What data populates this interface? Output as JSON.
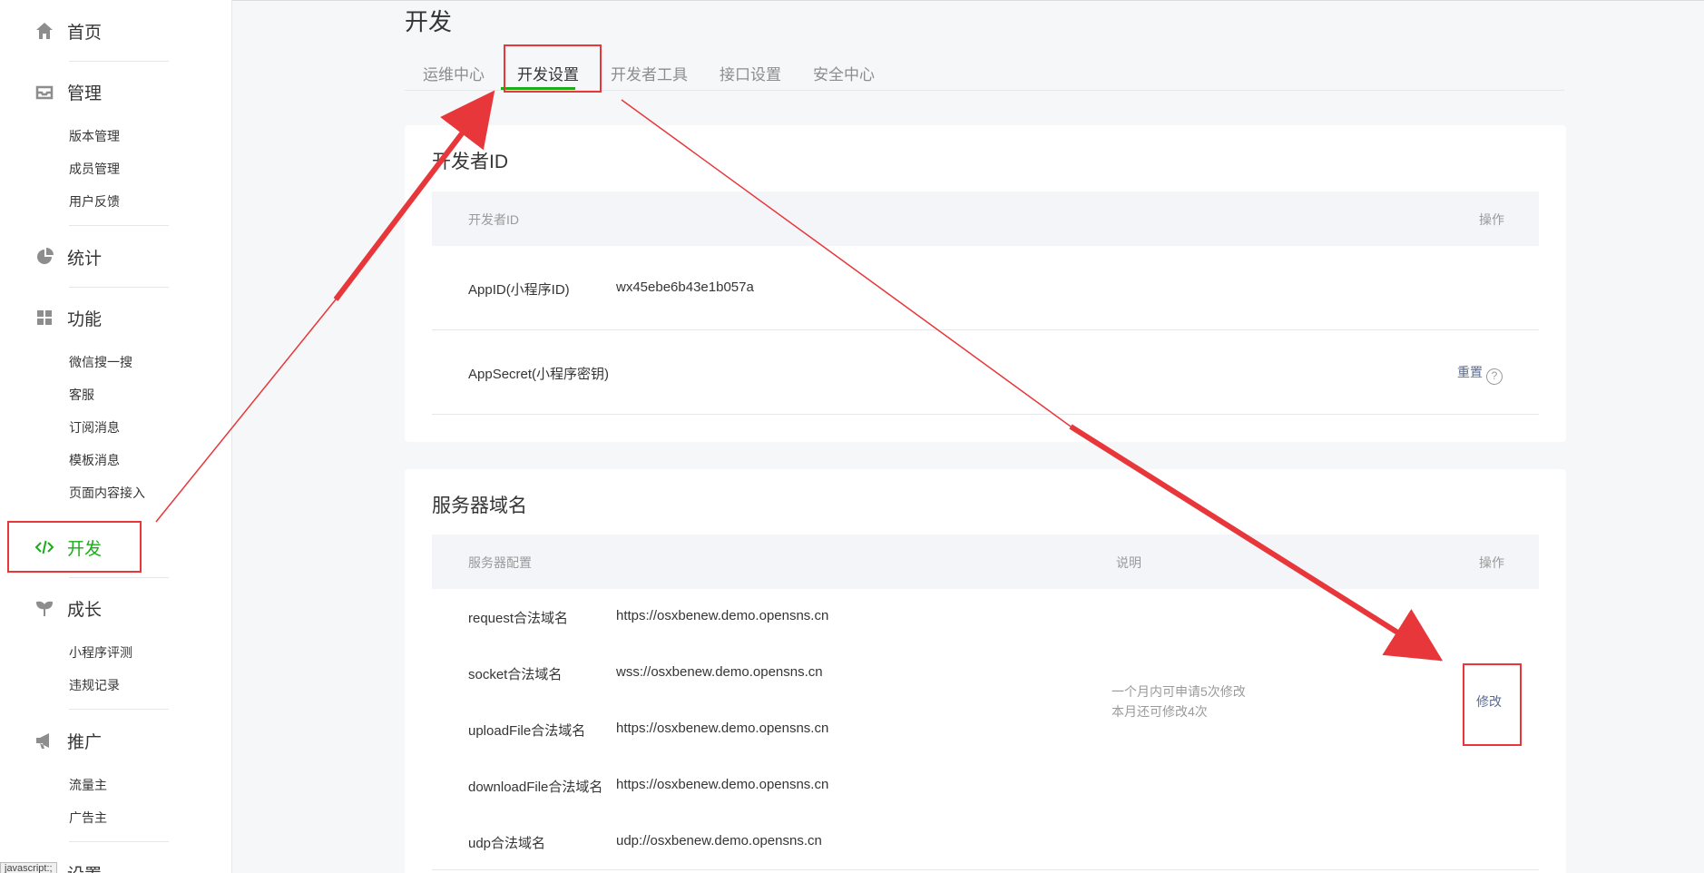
{
  "sidebar": {
    "home": "首页",
    "manage": "管理",
    "manage_items": [
      "版本管理",
      "成员管理",
      "用户反馈"
    ],
    "stats": "统计",
    "features": "功能",
    "feature_items": [
      "微信搜一搜",
      "客服",
      "订阅消息",
      "模板消息",
      "页面内容接入"
    ],
    "develop": "开发",
    "growth": "成长",
    "growth_items": [
      "小程序评测",
      "违规记录"
    ],
    "promote": "推广",
    "promote_items": [
      "流量主",
      "广告主"
    ],
    "settings": "设置"
  },
  "page": {
    "title": "开发",
    "tabs": [
      "运维中心",
      "开发设置",
      "开发者工具",
      "接口设置",
      "安全中心"
    ],
    "active_tab": "开发设置"
  },
  "developer_id": {
    "title": "开发者ID",
    "header_col1": "开发者ID",
    "header_action": "操作",
    "appid_label": "AppID(小程序ID)",
    "appid_value": "wx45ebe6b43e1b057a",
    "appsecret_label": "AppSecret(小程序密钥)",
    "reset_link": "重置",
    "help_glyph": "?"
  },
  "server_domain": {
    "title": "服务器域名",
    "header_col1": "服务器配置",
    "header_desc": "说明",
    "header_action": "操作",
    "rows": [
      {
        "label": "request合法域名",
        "value": "https://osxbenew.demo.opensns.cn"
      },
      {
        "label": "socket合法域名",
        "value": "wss://osxbenew.demo.opensns.cn"
      },
      {
        "label": "uploadFile合法域名",
        "value": "https://osxbenew.demo.opensns.cn"
      },
      {
        "label": "downloadFile合法域名",
        "value": "https://osxbenew.demo.opensns.cn"
      },
      {
        "label": "udp合法域名",
        "value": "udp://osxbenew.demo.opensns.cn"
      }
    ],
    "desc_line1": "一个月内可申请5次修改",
    "desc_line2": "本月还可修改4次",
    "modify_link": "修改"
  },
  "status_tip": "javascript:;",
  "colors": {
    "accent_green": "#1aad19",
    "link_blue": "#576b95",
    "annotation_red": "#e8373a"
  }
}
